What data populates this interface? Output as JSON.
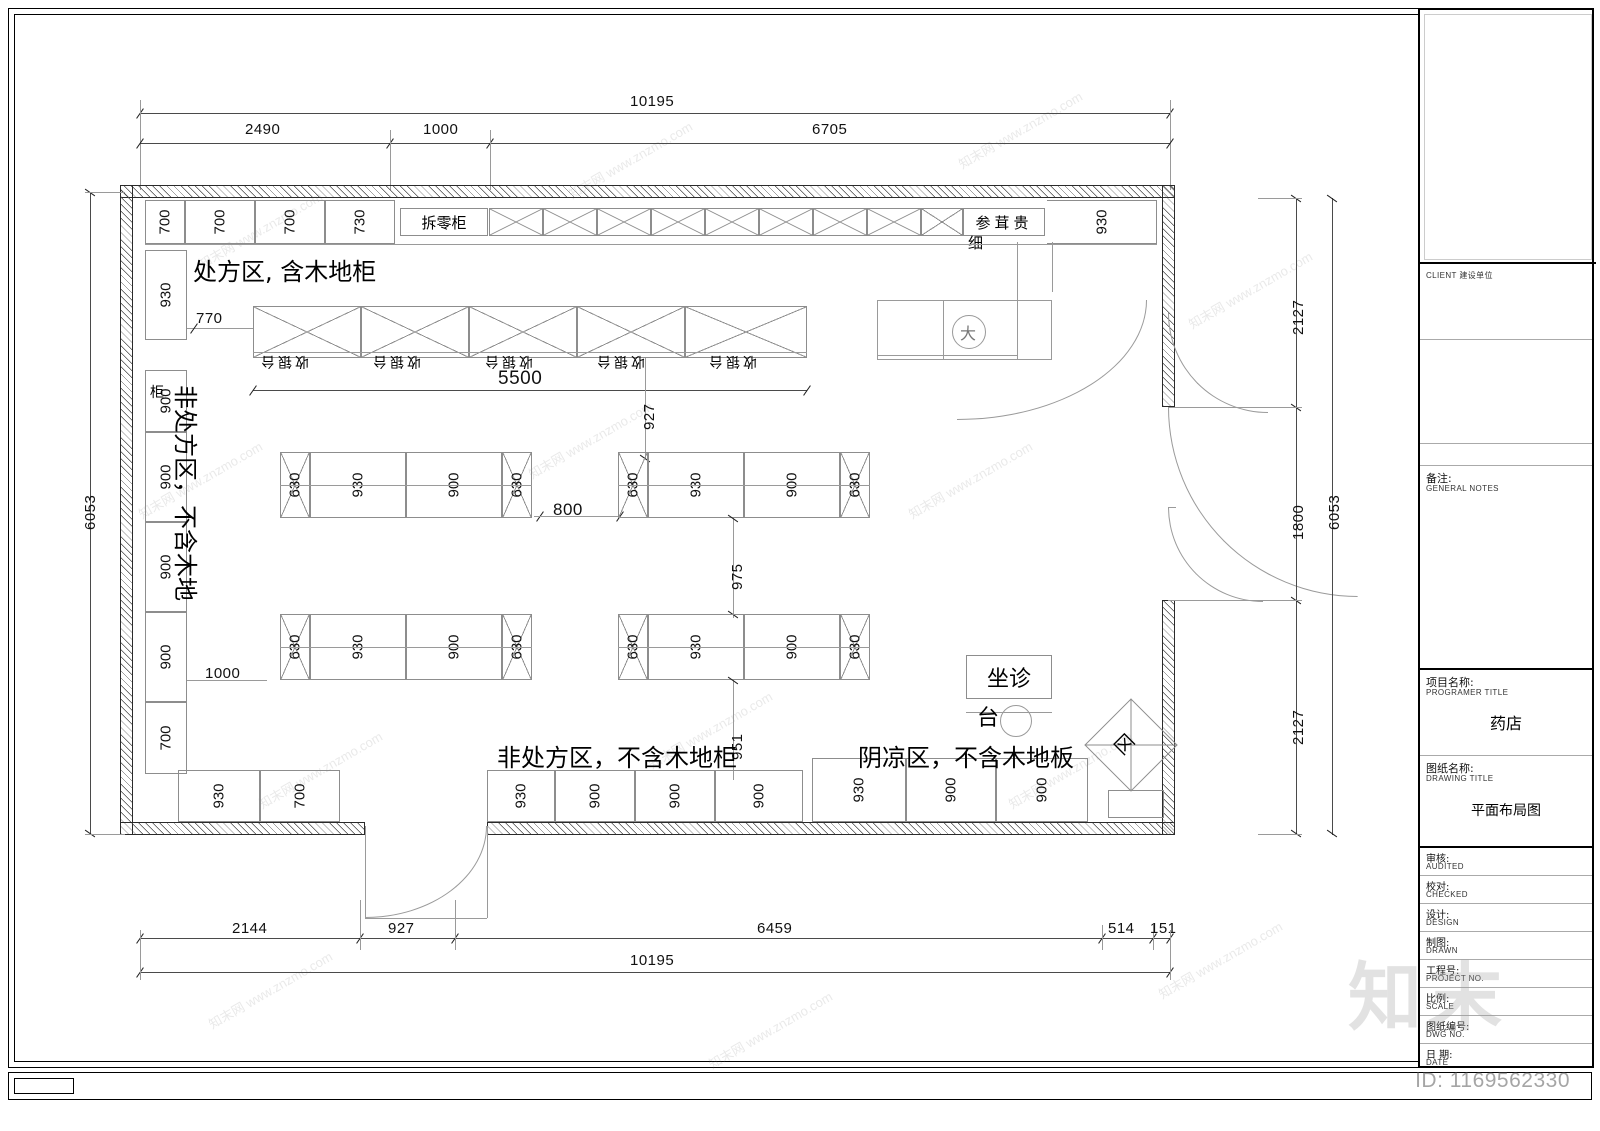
{
  "sheet": {
    "drawing_id": "ID: 1169562330",
    "watermark_text": "知末网 www.znzmo.com",
    "watermark_brand": "知末"
  },
  "titleblock": {
    "client": {
      "cn": "CLIENT  建设单位",
      "en": ""
    },
    "notes": {
      "cn": "备注:",
      "en": "GENERAL NOTES"
    },
    "project_name": {
      "cn": "项目名称:",
      "en": "PROGRAMER TITLE",
      "value": "药店"
    },
    "drawing_name": {
      "cn": "图纸名称:",
      "en": "DRAWING TITLE",
      "value": "平面布局图"
    },
    "rows": [
      {
        "cn": "审核:",
        "en": "AUDITED",
        "value": ""
      },
      {
        "cn": "校对:",
        "en": "CHECKED",
        "value": ""
      },
      {
        "cn": "设计:",
        "en": "DESIGN",
        "value": ""
      },
      {
        "cn": "制图:",
        "en": "DRAWN",
        "value": ""
      },
      {
        "cn": "工程号:",
        "en": "PROJECT NO.",
        "value": ""
      },
      {
        "cn": "比例:",
        "en": "SCALE",
        "value": ""
      },
      {
        "cn": "图纸编号:",
        "en": "DWG NO.",
        "value": ""
      },
      {
        "cn": "日 期:",
        "en": "DATE",
        "value": ""
      }
    ]
  },
  "plan": {
    "zones": [
      {
        "id": "prescription",
        "label": "处方区, 含木地柜"
      },
      {
        "id": "otc-left",
        "label": "非处方区，不含木地"
      },
      {
        "id": "otc-bottom",
        "label": "非处方区，不含木地柜"
      },
      {
        "id": "cool",
        "label": "阴凉区，不含木地板"
      }
    ],
    "fixtures": [
      {
        "id": "bulk-cabinet",
        "label": "拆零柜"
      },
      {
        "id": "precious-herbs",
        "label": "参茸贵"
      },
      {
        "id": "precious-herbs-2",
        "label": "细"
      },
      {
        "id": "consult-desk",
        "label": "坐诊"
      },
      {
        "id": "consult-desk-2",
        "label": "台"
      },
      {
        "id": "counter-unit",
        "label": "收银台"
      },
      {
        "id": "stool-mark",
        "label": "大"
      },
      {
        "id": "corner-mark",
        "label": "区"
      }
    ],
    "overall": {
      "top_total": "10195",
      "bottom_total": "10195",
      "left_total": "6053",
      "right_total": "6053"
    },
    "dims_top_chain": [
      "2490",
      "1000",
      "6705"
    ],
    "dims_bottom_chain": [
      "2144",
      "927",
      "6459",
      "514",
      "151"
    ],
    "dims_right_chain": [
      "2127",
      "1800",
      "2127"
    ],
    "dims_left_shelves": [
      "930",
      "900",
      "900",
      "900",
      "900",
      "700"
    ],
    "dims_top_shelves": [
      "700",
      "700",
      "730",
      "930"
    ],
    "dims_bottom_shelves_left": [
      "930",
      "700"
    ],
    "dims_bottom_shelves_right": [
      "930",
      "900",
      "900",
      "900",
      "930",
      "900",
      "900"
    ],
    "dims_misc": [
      "770",
      "5500",
      "800",
      "1000",
      "927",
      "975",
      "951"
    ],
    "island_top_left": [
      "630",
      "930",
      "900",
      "630"
    ],
    "island_top_right": [
      "630",
      "930",
      "900",
      "630"
    ],
    "island_bottom_left": [
      "630",
      "930",
      "900",
      "630"
    ],
    "island_bottom_right": [
      "630",
      "930",
      "900",
      "630"
    ]
  }
}
